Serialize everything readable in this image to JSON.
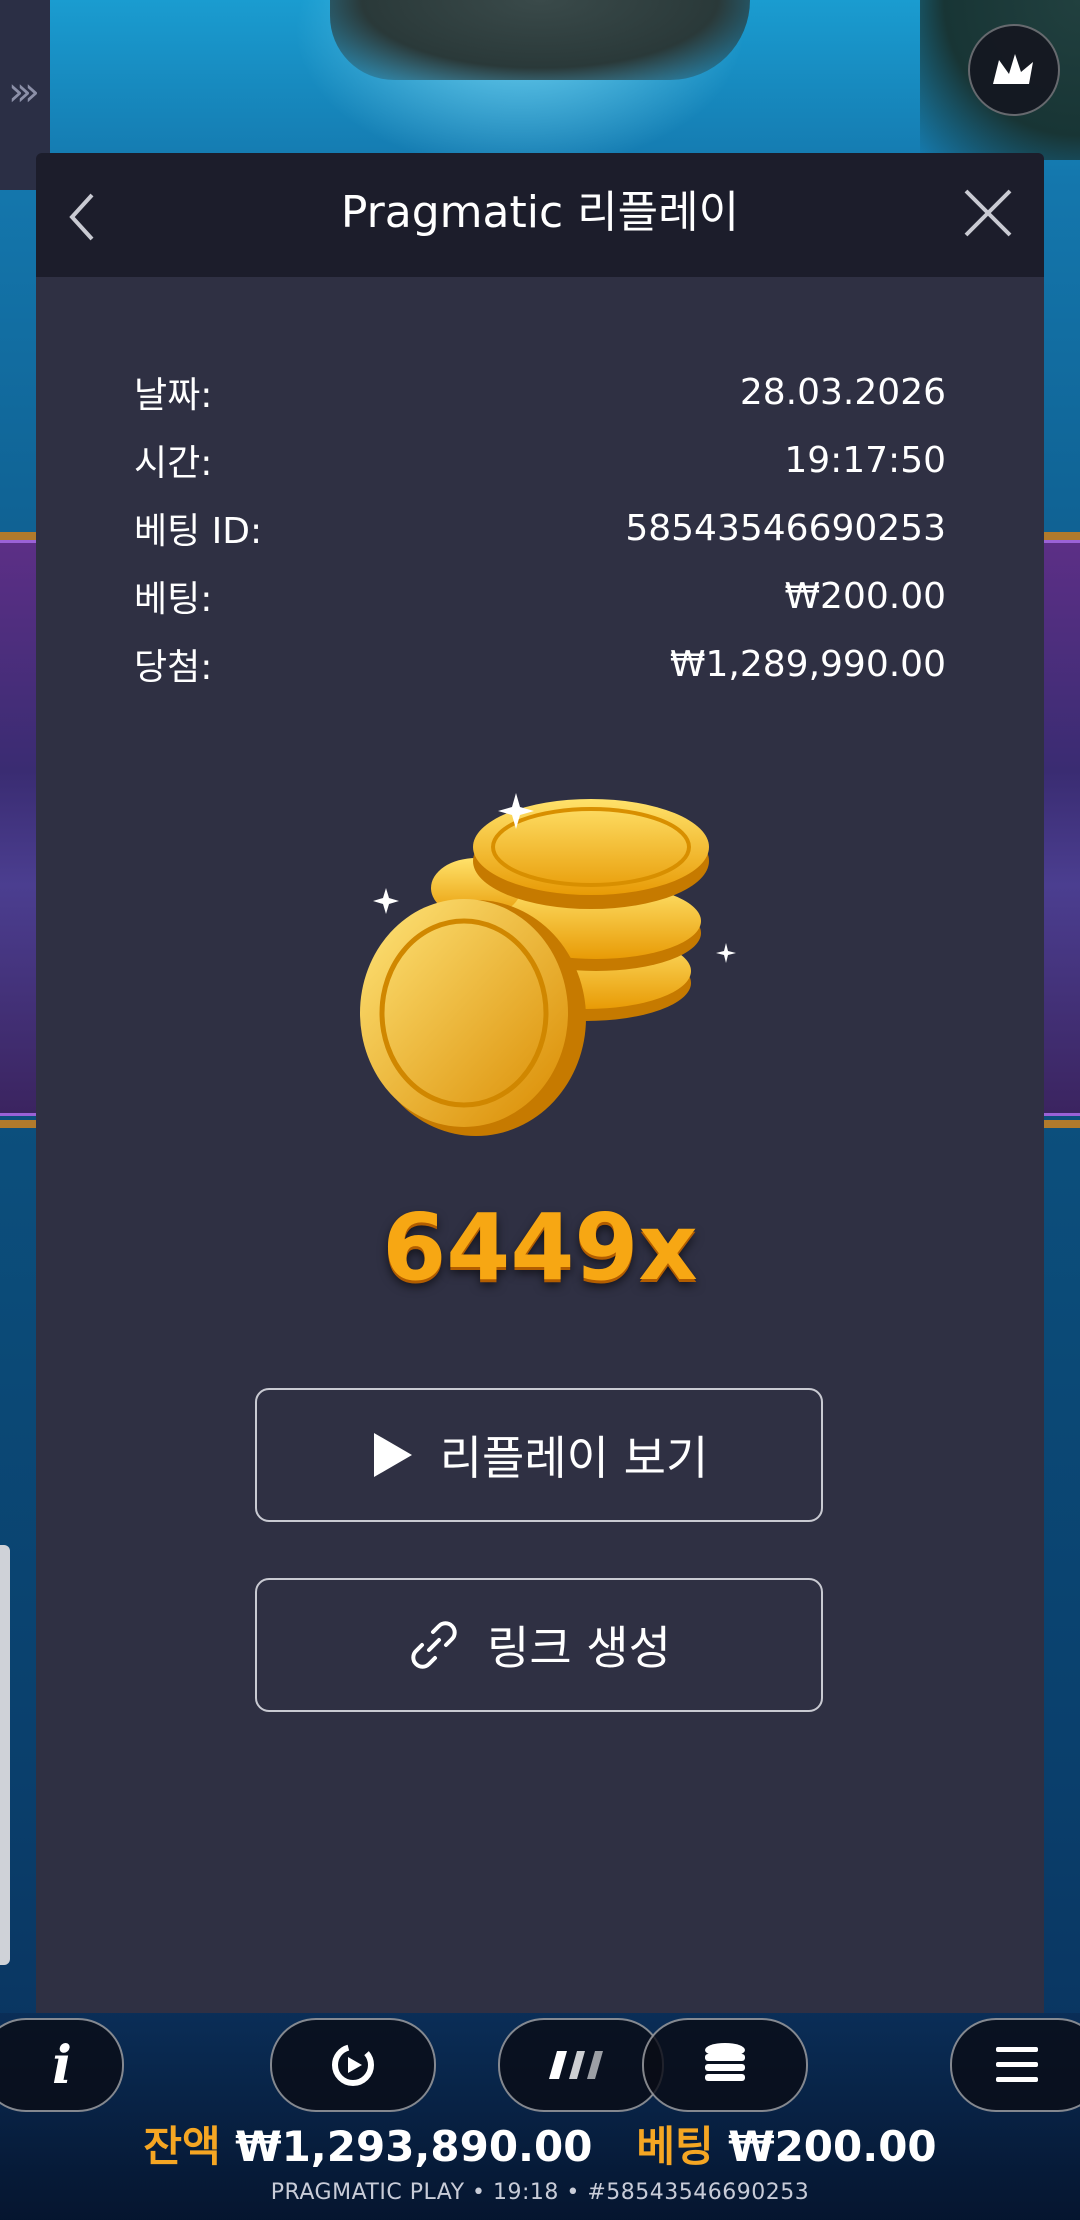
{
  "modal": {
    "title": "Pragmatic 리플레이",
    "info": [
      {
        "label": "날짜:",
        "value": "28.03.2026"
      },
      {
        "label": "시간:",
        "value": "19:17:50"
      },
      {
        "label": "베팅 ID:",
        "value": "58543546690253"
      },
      {
        "label": "베팅:",
        "value": "₩200.00"
      },
      {
        "label": "당첨:",
        "value": "₩1,289,990.00"
      }
    ],
    "multiplier": "6449x",
    "replay_button": "리플레이 보기",
    "link_button": "링크 생성"
  },
  "bottom": {
    "balance_label": "잔액",
    "balance_value": "₩1,293,890.00",
    "bet_label": "베팅",
    "bet_value": "₩200.00",
    "footer": "PRAGMATIC PLAY • 19:18 • #58543546690253",
    "info_label": "i"
  },
  "colors": {
    "modal_bg": "#2f3043",
    "header_bg": "#1c1d2b",
    "accent_gold": "#f5a623"
  }
}
